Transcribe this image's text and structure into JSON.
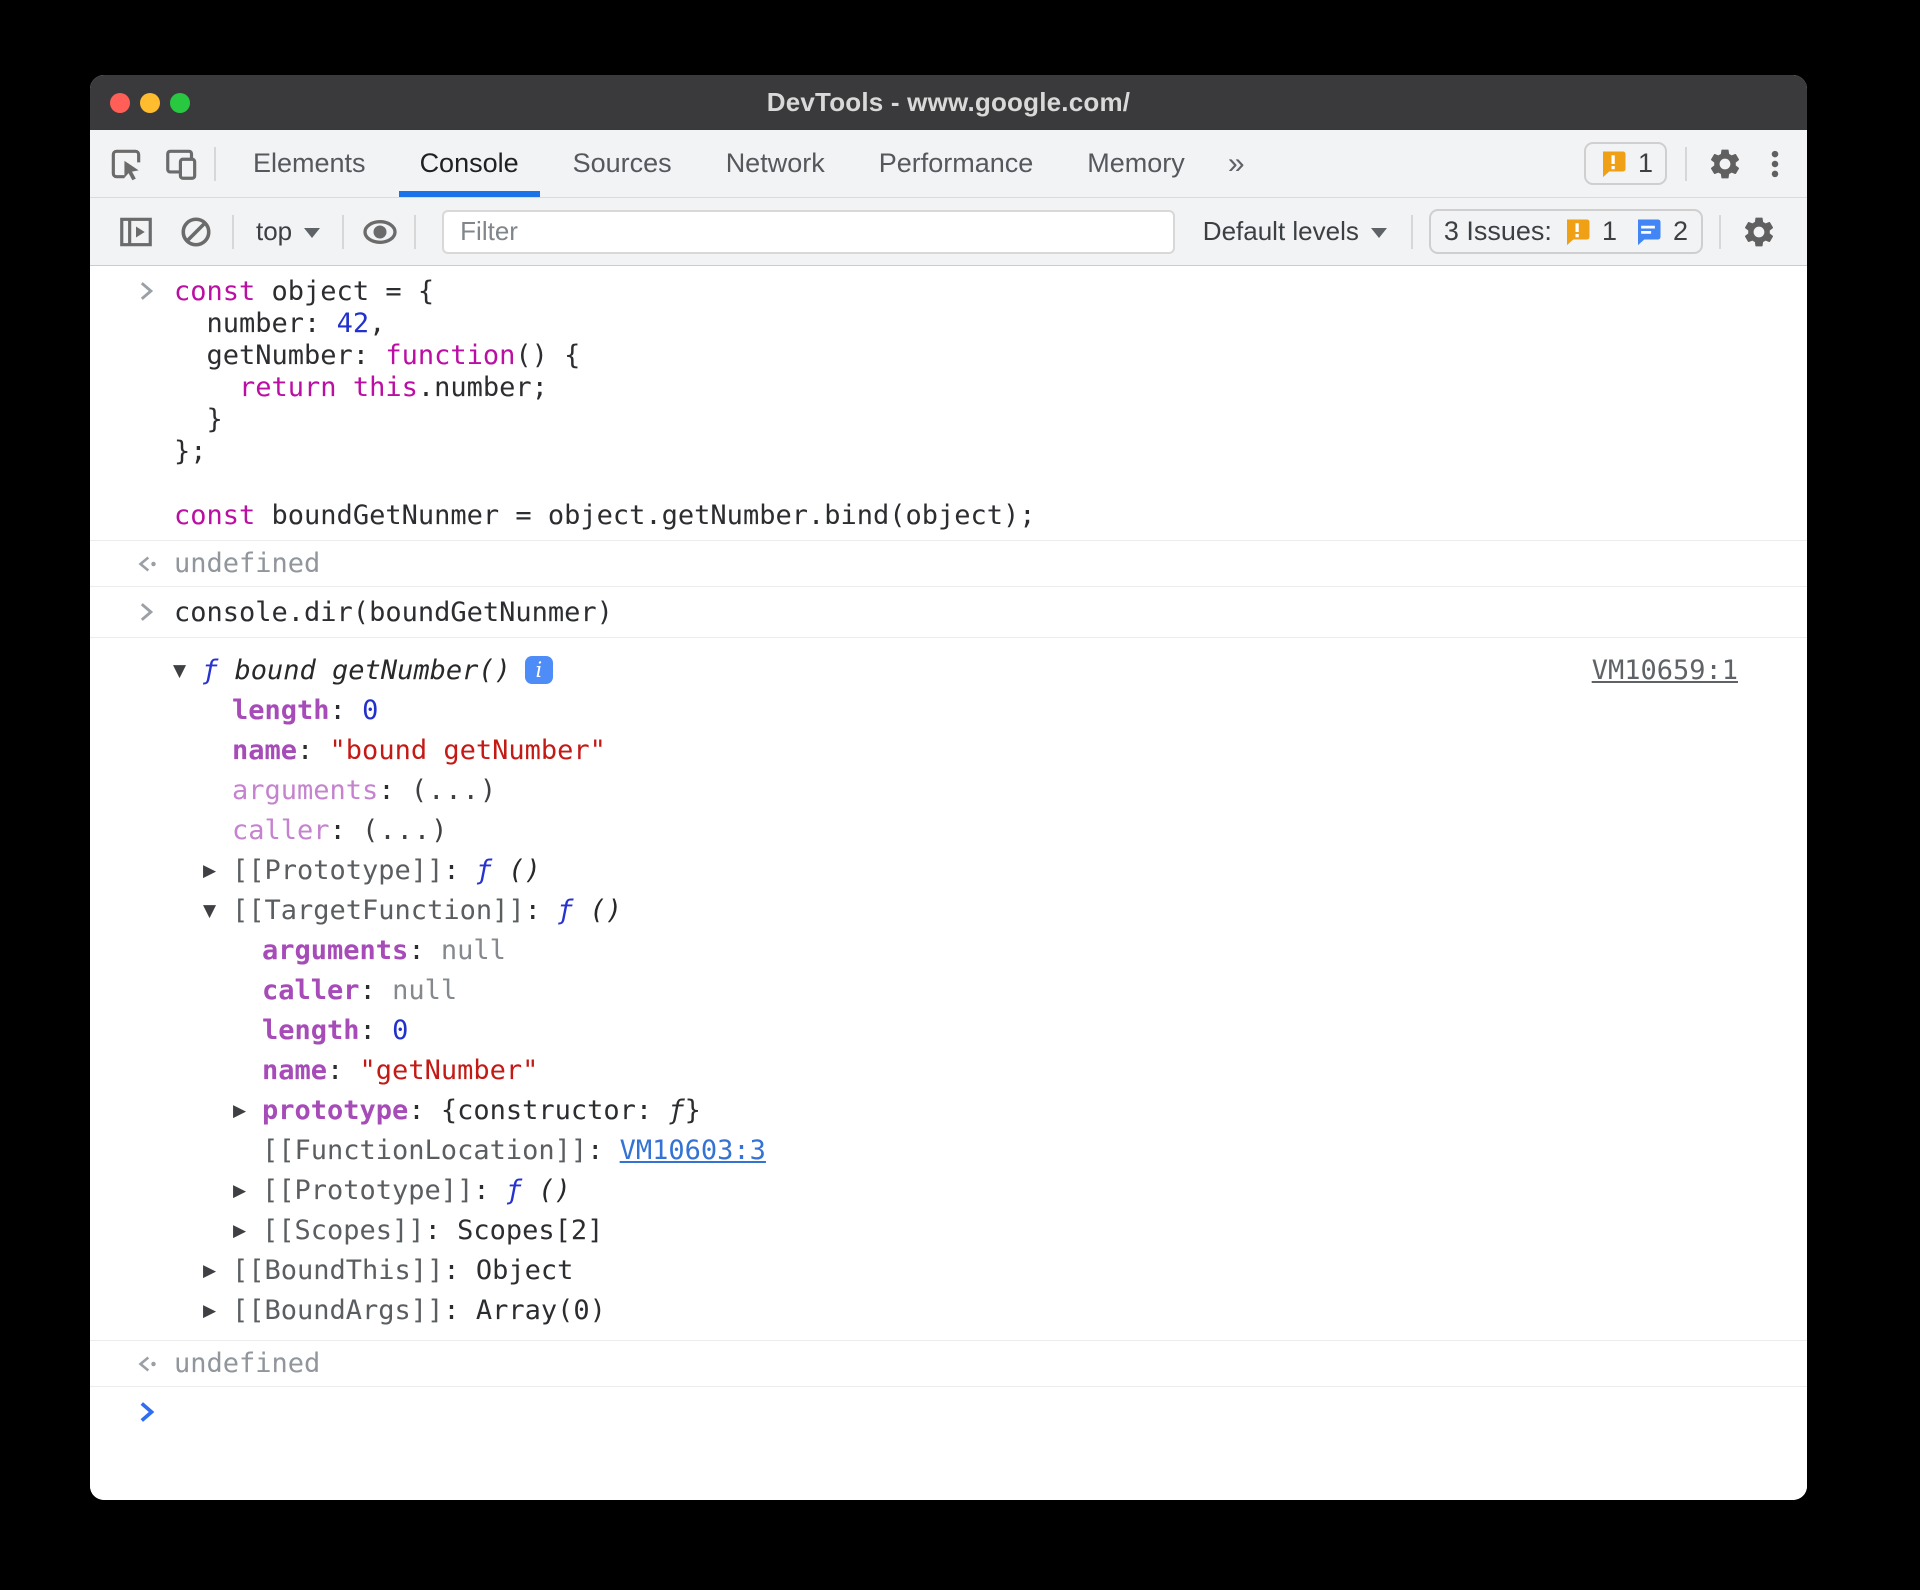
{
  "window": {
    "title": "DevTools - www.google.com/"
  },
  "traffic_lights": {
    "close": "#ff5f57",
    "minimize": "#febc2e",
    "zoom": "#28c840"
  },
  "tabs": {
    "items": [
      "Elements",
      "Console",
      "Sources",
      "Network",
      "Performance",
      "Memory"
    ],
    "active": "Console",
    "overflow": "»",
    "error_count": "1"
  },
  "toolbar": {
    "context_label": "top",
    "filter_placeholder": "Filter",
    "levels_label": "Default levels",
    "issues": {
      "label": "3 Issues:",
      "warning_count": "1",
      "message_count": "2"
    }
  },
  "colors": {
    "accent_blue": "#1a73e8",
    "warning_orange": "#efa014",
    "message_blue": "#4285f4",
    "keyword": "#bb0fa3",
    "number": "#2331cc",
    "string": "#c41a16",
    "property": "#a64bb8",
    "function_f": "#2733d0"
  },
  "console": {
    "entries": [
      {
        "type": "input",
        "lines": [
          [
            {
              "t": "const",
              "c": "kw"
            },
            {
              "t": " object = {",
              "c": "pl"
            }
          ],
          [
            {
              "t": "  number: ",
              "c": "pl"
            },
            {
              "t": "42",
              "c": "num"
            },
            {
              "t": ",",
              "c": "pl"
            }
          ],
          [
            {
              "t": "  getNumber: ",
              "c": "pl"
            },
            {
              "t": "function",
              "c": "kw"
            },
            {
              "t": "() {",
              "c": "pl"
            }
          ],
          [
            {
              "t": "    ",
              "c": "pl"
            },
            {
              "t": "return",
              "c": "kw"
            },
            {
              "t": " ",
              "c": "pl"
            },
            {
              "t": "this",
              "c": "kw"
            },
            {
              "t": ".number;",
              "c": "pl"
            }
          ],
          [
            {
              "t": "  }",
              "c": "pl"
            }
          ],
          [
            {
              "t": "};",
              "c": "pl"
            }
          ],
          [],
          [
            {
              "t": "const",
              "c": "kw"
            },
            {
              "t": " boundGetNunmer = object.getNumber.bind(object);",
              "c": "pl"
            }
          ]
        ]
      },
      {
        "type": "result",
        "text": "undefined"
      },
      {
        "type": "input",
        "lines": [
          [
            {
              "t": "console.dir(boundGetNunmer)",
              "c": "pl"
            }
          ]
        ]
      },
      {
        "type": "tree",
        "link": "VM10659:1",
        "rows": [
          {
            "lv": 0,
            "tri": "open",
            "badge": "i",
            "tokens": [
              {
                "t": "ƒ ",
                "c": "fn"
              },
              {
                "t": "bound getNumber()",
                "c": "fnsig"
              }
            ]
          },
          {
            "lv": 1,
            "tokens": [
              {
                "t": "length",
                "c": "prop"
              },
              {
                "t": ": ",
                "c": "pl"
              },
              {
                "t": "0",
                "c": "num"
              }
            ]
          },
          {
            "lv": 1,
            "tokens": [
              {
                "t": "name",
                "c": "prop"
              },
              {
                "t": ": ",
                "c": "pl"
              },
              {
                "t": "\"bound getNumber\"",
                "c": "str"
              }
            ]
          },
          {
            "lv": 1,
            "tokens": [
              {
                "t": "arguments",
                "c": "propdim"
              },
              {
                "t": ": ",
                "c": "pl"
              },
              {
                "t": "(...)",
                "c": "dots"
              }
            ]
          },
          {
            "lv": 1,
            "tokens": [
              {
                "t": "caller",
                "c": "propdim"
              },
              {
                "t": ": ",
                "c": "pl"
              },
              {
                "t": "(...)",
                "c": "dots"
              }
            ]
          },
          {
            "lv": 1,
            "tri": "closed",
            "tokens": [
              {
                "t": "[[Prototype]]",
                "c": "internal"
              },
              {
                "t": ": ",
                "c": "pl"
              },
              {
                "t": "ƒ ",
                "c": "fn"
              },
              {
                "t": "()",
                "c": "fnsig"
              }
            ]
          },
          {
            "lv": 1,
            "tri": "open",
            "tokens": [
              {
                "t": "[[TargetFunction]]",
                "c": "internal"
              },
              {
                "t": ": ",
                "c": "pl"
              },
              {
                "t": "ƒ ",
                "c": "fn"
              },
              {
                "t": "()",
                "c": "fnsig"
              }
            ]
          },
          {
            "lv": 2,
            "tokens": [
              {
                "t": "arguments",
                "c": "prop"
              },
              {
                "t": ": ",
                "c": "pl"
              },
              {
                "t": "null",
                "c": "gray"
              }
            ]
          },
          {
            "lv": 2,
            "tokens": [
              {
                "t": "caller",
                "c": "prop"
              },
              {
                "t": ": ",
                "c": "pl"
              },
              {
                "t": "null",
                "c": "gray"
              }
            ]
          },
          {
            "lv": 2,
            "tokens": [
              {
                "t": "length",
                "c": "prop"
              },
              {
                "t": ": ",
                "c": "pl"
              },
              {
                "t": "0",
                "c": "num"
              }
            ]
          },
          {
            "lv": 2,
            "tokens": [
              {
                "t": "name",
                "c": "prop"
              },
              {
                "t": ": ",
                "c": "pl"
              },
              {
                "t": "\"getNumber\"",
                "c": "str"
              }
            ]
          },
          {
            "lv": 2,
            "tri": "closed",
            "tokens": [
              {
                "t": "prototype",
                "c": "prop"
              },
              {
                "t": ": ",
                "c": "pl"
              },
              {
                "t": "{constructor: ",
                "c": "pl"
              },
              {
                "t": "ƒ",
                "c": "fnplain"
              },
              {
                "t": "}",
                "c": "pl"
              }
            ]
          },
          {
            "lv": 2,
            "tokens": [
              {
                "t": "[[FunctionLocation]]",
                "c": "internal"
              },
              {
                "t": ": ",
                "c": "pl"
              },
              {
                "t": "VM10603:3",
                "c": "link"
              }
            ]
          },
          {
            "lv": 2,
            "tri": "closed",
            "tokens": [
              {
                "t": "[[Prototype]]",
                "c": "internal"
              },
              {
                "t": ": ",
                "c": "pl"
              },
              {
                "t": "ƒ ",
                "c": "fn"
              },
              {
                "t": "()",
                "c": "fnsig"
              }
            ]
          },
          {
            "lv": 2,
            "tri": "closed",
            "tokens": [
              {
                "t": "[[Scopes]]",
                "c": "internal"
              },
              {
                "t": ": ",
                "c": "pl"
              },
              {
                "t": "Scopes[2]",
                "c": "pl"
              }
            ]
          },
          {
            "lv": 1,
            "tri": "closed",
            "tokens": [
              {
                "t": "[[BoundThis]]",
                "c": "internal"
              },
              {
                "t": ": ",
                "c": "pl"
              },
              {
                "t": "Object",
                "c": "pl"
              }
            ]
          },
          {
            "lv": 1,
            "tri": "closed",
            "tokens": [
              {
                "t": "[[BoundArgs]]",
                "c": "internal"
              },
              {
                "t": ": ",
                "c": "pl"
              },
              {
                "t": "Array(0)",
                "c": "pl"
              }
            ]
          }
        ]
      },
      {
        "type": "result",
        "text": "undefined"
      },
      {
        "type": "prompt"
      }
    ]
  }
}
